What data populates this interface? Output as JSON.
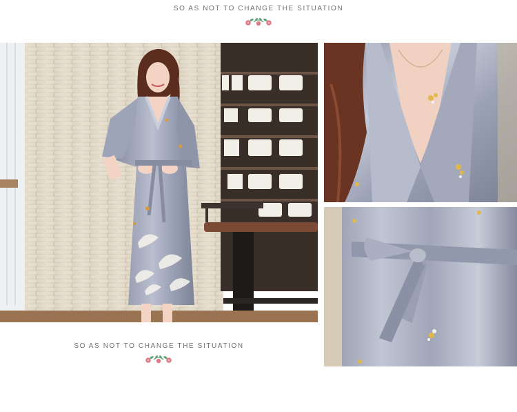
{
  "captions": {
    "top": "SO AS NOT TO CHANGE THE SITUATION",
    "bottom": "SO AS NOT TO CHANGE THE SITUATION"
  },
  "photos": {
    "main": "model-in-grey-satin-robe",
    "detail_top": "robe-neckline-detail",
    "detail_bottom": "robe-belt-detail"
  },
  "colors": {
    "satin": "#9da3b6",
    "satin_dark": "#7d8497",
    "satin_light": "#c3c8d6",
    "stone_wall": "#ddd4c3",
    "floor": "#a07a55",
    "flower_pink": "#e07a86",
    "leaf_green": "#5fa47a"
  }
}
